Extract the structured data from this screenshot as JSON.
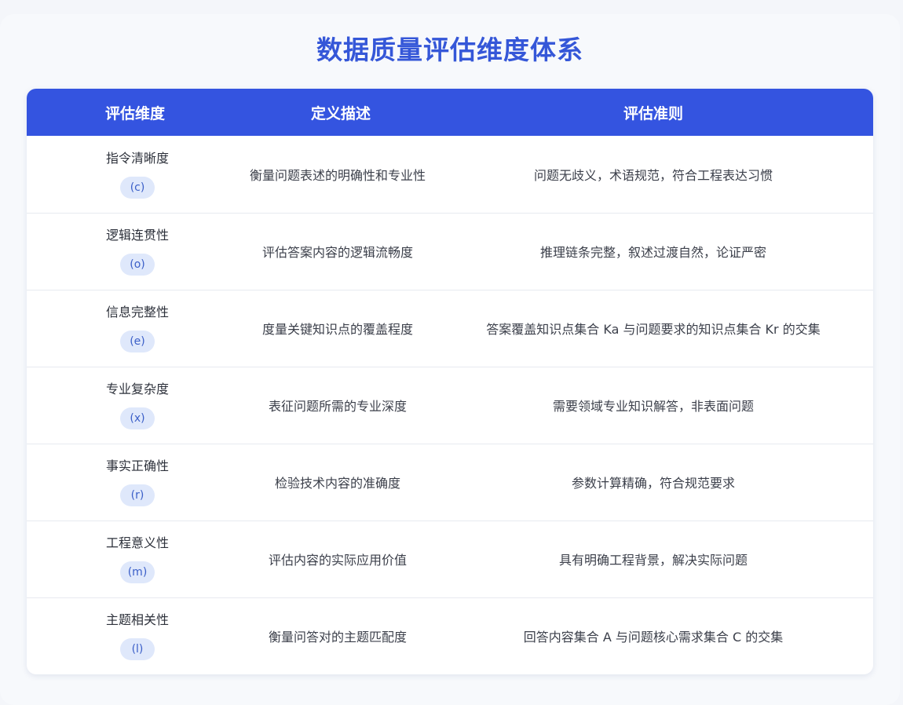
{
  "title": "数据质量评估维度体系",
  "table": {
    "headers": [
      "评估维度",
      "定义描述",
      "评估准则"
    ],
    "rows": [
      {
        "dimension": "指令清晰度",
        "code": "(c)",
        "definition": "衡量问题表述的明确性和专业性",
        "criteria": "问题无歧义，术语规范，符合工程表达习惯"
      },
      {
        "dimension": "逻辑连贯性",
        "code": "(o)",
        "definition": "评估答案内容的逻辑流畅度",
        "criteria": "推理链条完整，叙述过渡自然，论证严密"
      },
      {
        "dimension": "信息完整性",
        "code": "(e)",
        "definition": "度量关键知识点的覆盖程度",
        "criteria": "答案覆盖知识点集合 Ka 与问题要求的知识点集合 Kr 的交集"
      },
      {
        "dimension": "专业复杂度",
        "code": "(x)",
        "definition": "表征问题所需的专业深度",
        "criteria": "需要领域专业知识解答，非表面问题"
      },
      {
        "dimension": "事实正确性",
        "code": "(r)",
        "definition": "检验技术内容的准确度",
        "criteria": "参数计算精确，符合规范要求"
      },
      {
        "dimension": "工程意义性",
        "code": "(m)",
        "definition": "评估内容的实际应用价值",
        "criteria": "具有明确工程背景，解决实际问题"
      },
      {
        "dimension": "主题相关性",
        "code": "(l)",
        "definition": "衡量问答对的主题匹配度",
        "criteria": "回答内容集合 A 与问题核心需求集合 C 的交集"
      }
    ]
  },
  "colors": {
    "accent": "#3454e0",
    "title": "#3557d8",
    "badge_bg": "#dfe8fb",
    "badge_text": "#3b5fc8"
  }
}
